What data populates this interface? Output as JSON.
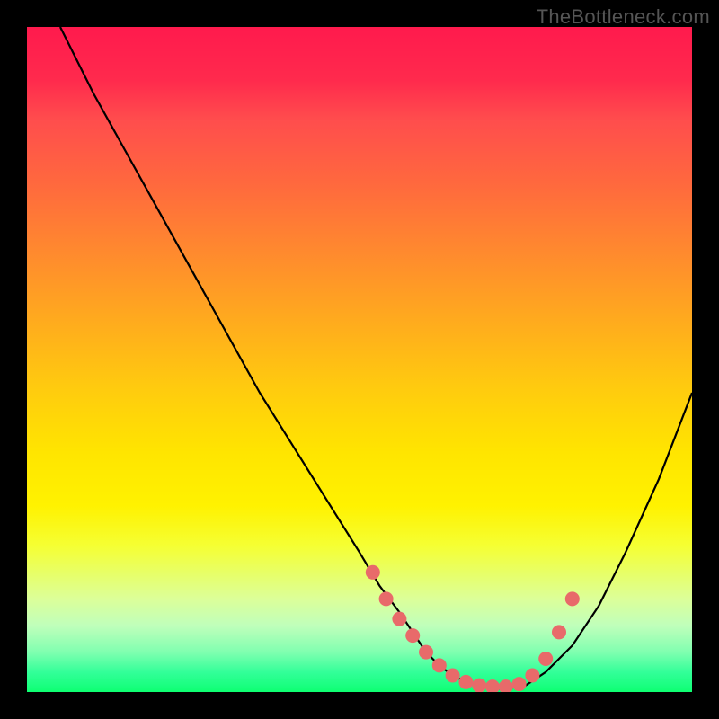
{
  "watermark": "TheBottleneck.com",
  "chart_data": {
    "type": "line",
    "title": "",
    "xlabel": "",
    "ylabel": "",
    "xlim": [
      0,
      100
    ],
    "ylim": [
      0,
      100
    ],
    "grid": false,
    "series": [
      {
        "name": "curve",
        "x": [
          5,
          10,
          15,
          20,
          25,
          30,
          35,
          40,
          45,
          50,
          53,
          56,
          58,
          60,
          62,
          64,
          66,
          68,
          70,
          72,
          75,
          78,
          82,
          86,
          90,
          95,
          100
        ],
        "y": [
          100,
          90,
          81,
          72,
          63,
          54,
          45,
          37,
          29,
          21,
          16,
          12,
          9,
          6,
          4,
          2.5,
          1.5,
          1,
          0.5,
          0.5,
          1,
          3,
          7,
          13,
          21,
          32,
          45
        ]
      }
    ],
    "markers": {
      "name": "fit-points",
      "color": "#e86a6a",
      "x": [
        52,
        54,
        56,
        58,
        60,
        62,
        64,
        66,
        68,
        70,
        72,
        74,
        76,
        78,
        80,
        82
      ],
      "y": [
        18,
        14,
        11,
        8.5,
        6,
        4,
        2.5,
        1.5,
        1,
        0.8,
        0.8,
        1.2,
        2.5,
        5,
        9,
        14
      ]
    }
  }
}
